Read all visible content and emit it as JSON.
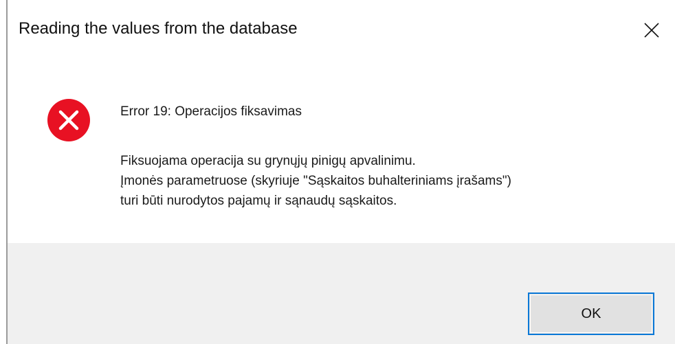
{
  "dialog": {
    "title": "Reading the values from the database",
    "close_icon": "close-icon",
    "icon": "error-icon",
    "heading": "Error 19: Operacijos fiksavimas",
    "message_lines": [
      "Fiksuojama operacija su grynųjų pinigų apvalinimu.",
      "Įmonės parametruose (skyriuje \"Sąskaitos buhalteriniams įrašams\")",
      "turi būti nurodytos pajamų ir sąnaudų sąskaitos."
    ],
    "ok_label": "OK"
  },
  "colors": {
    "error_red": "#e81123",
    "button_border": "#0a78d7",
    "footer_bg": "#f0f0f0"
  }
}
